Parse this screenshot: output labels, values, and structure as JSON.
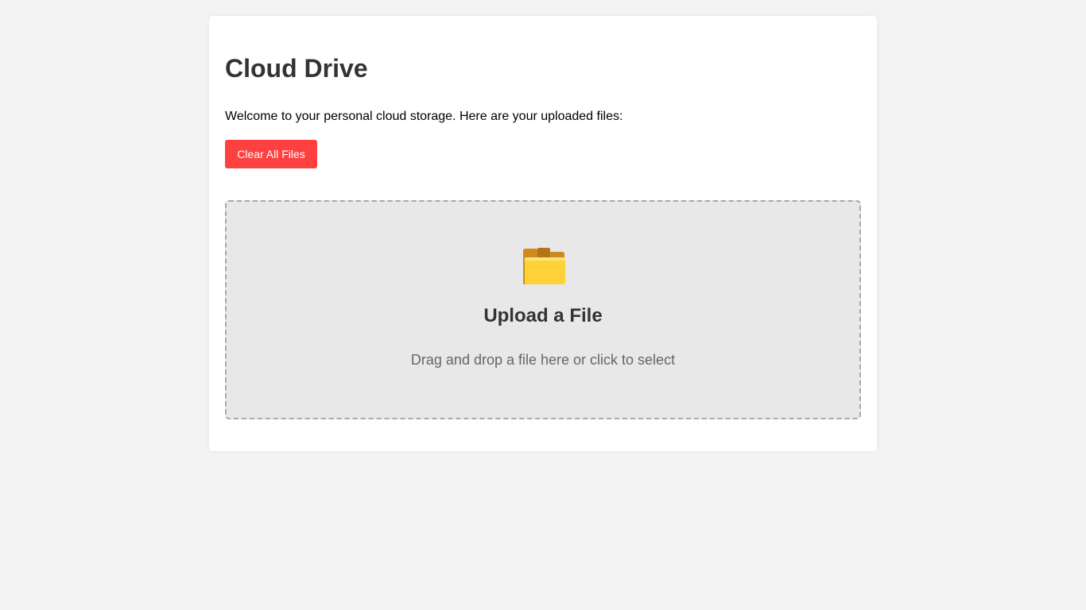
{
  "page": {
    "title": "Cloud Drive",
    "intro": "Welcome to your personal cloud storage. Here are your uploaded files:"
  },
  "actions": {
    "clear_label": "Clear All Files"
  },
  "upload": {
    "icon": "folder-icon",
    "title": "Upload a File",
    "hint": "Drag and drop a file here or click to select"
  },
  "colors": {
    "background": "#f3f3f3",
    "card": "#ffffff",
    "danger": "#ff4040",
    "dropzone": "#e8e8e8",
    "dropzone_border": "#a9a9a9",
    "heading": "#333333",
    "hint": "#666666"
  }
}
